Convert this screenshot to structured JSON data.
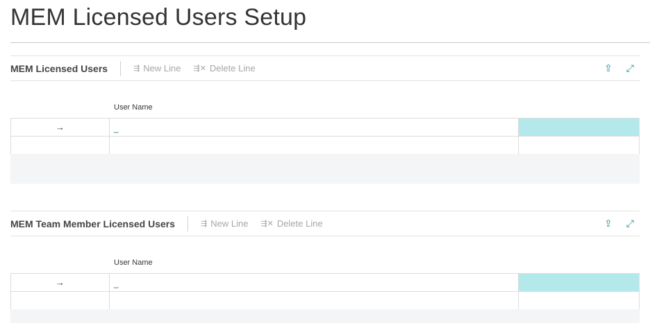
{
  "page": {
    "title": "MEM Licensed Users Setup"
  },
  "parts": [
    {
      "title": "MEM Licensed Users",
      "new_line": "New Line",
      "delete_line": "Delete Line",
      "column": "User Name",
      "rows": [
        {
          "marker": "→",
          "user_name": "_"
        },
        {
          "marker": "",
          "user_name": ""
        }
      ]
    },
    {
      "title": "MEM Team Member Licensed Users",
      "new_line": "New Line",
      "delete_line": "Delete Line",
      "column": "User Name",
      "rows": [
        {
          "marker": "→",
          "user_name": "_"
        },
        {
          "marker": "",
          "user_name": ""
        }
      ]
    }
  ],
  "icons": {
    "share": "share-icon",
    "expand": "expand-icon",
    "new": "new-line-icon",
    "delete": "delete-line-icon"
  },
  "colors": {
    "accent": "#2a8f9a",
    "selected": "#b4e9ec"
  }
}
